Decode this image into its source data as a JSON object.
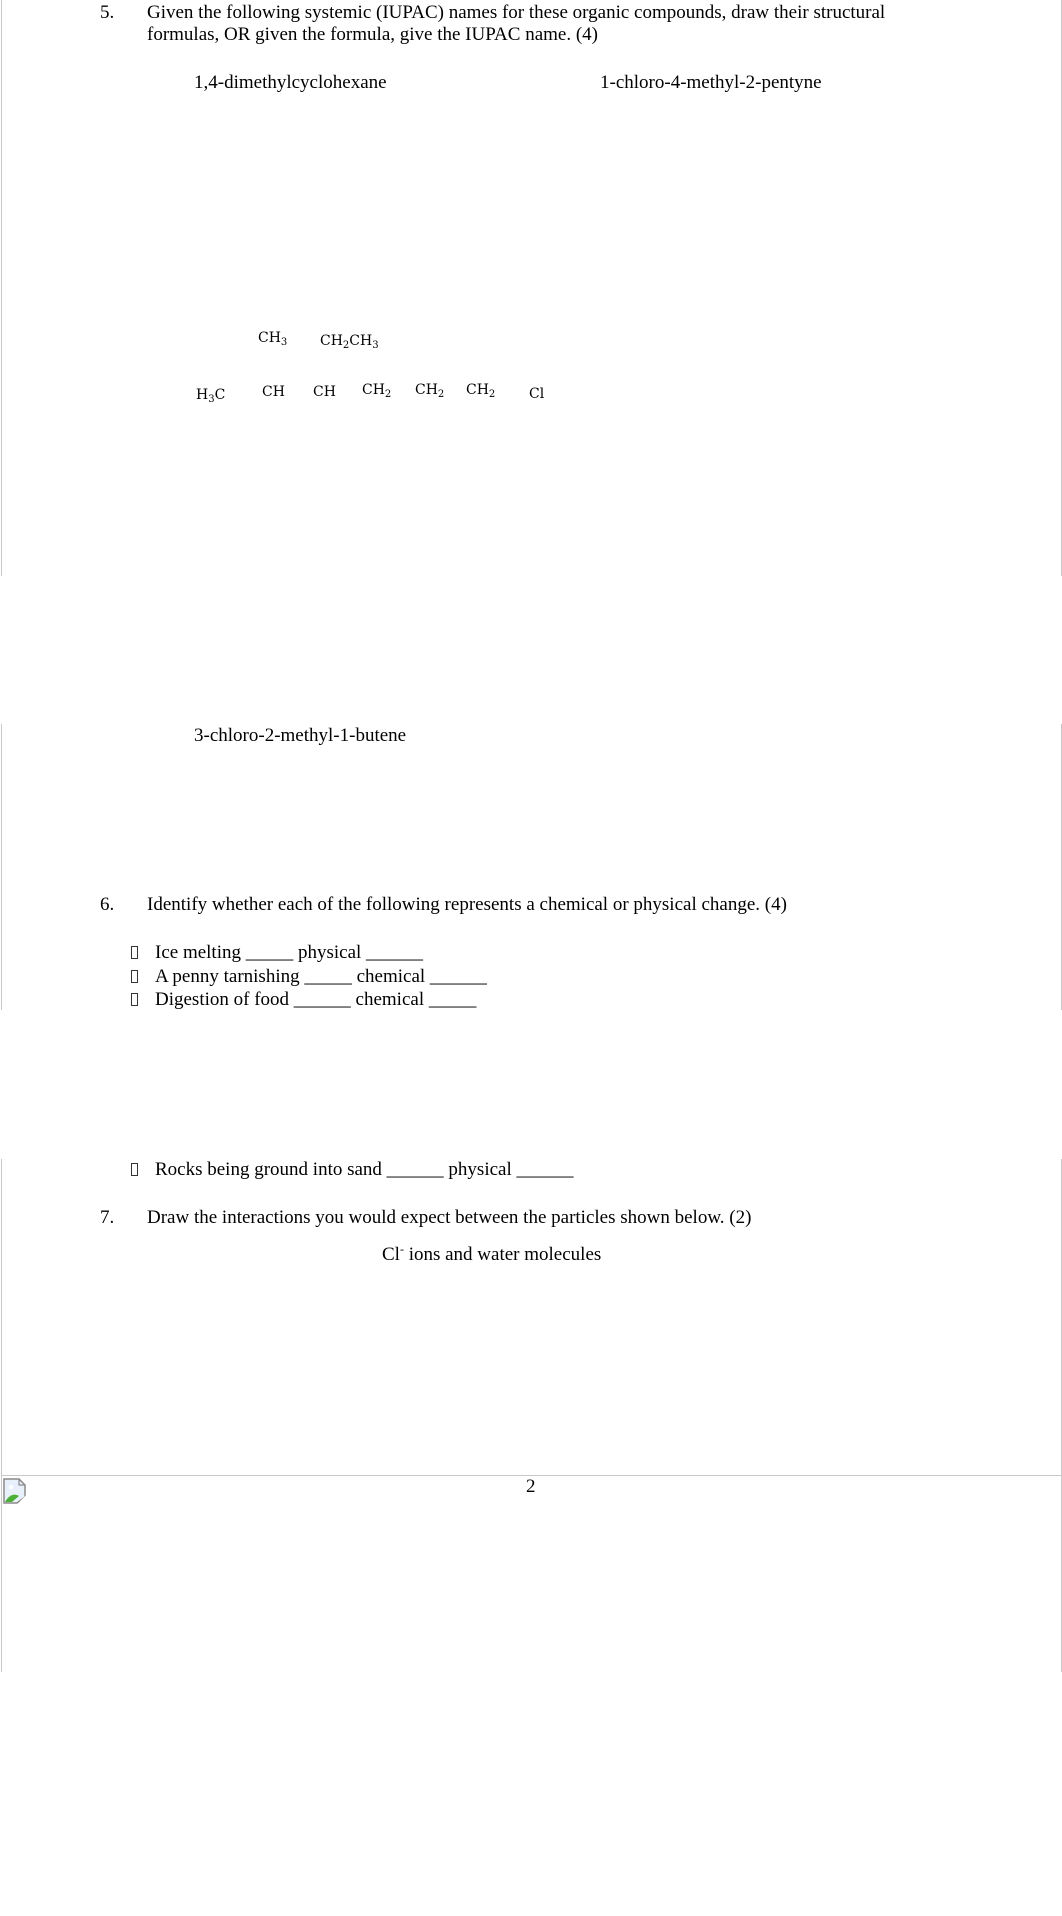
{
  "q5": {
    "number": "5.",
    "line1": "Given the following systemic (IUPAC) names for these organic compounds, draw their  structural",
    "line2": "formulas,  OR  given the formula, give the IUPAC name. (4)",
    "names": [
      "1,4-dimethylcyclohexane",
      "1-chloro-4-methyl-2-pentyne",
      "3-chloro-2-methyl-1-butene"
    ],
    "formula": {
      "top": [
        {
          "base": "CH",
          "sub": "3"
        },
        {
          "base": "CH",
          "sub": "2",
          "tail": "CH",
          "tailsub": "3"
        }
      ],
      "chain": [
        {
          "pre": "H",
          "presub": "3",
          "base": "C"
        },
        {
          "base": "CH"
        },
        {
          "base": "CH"
        },
        {
          "base": "CH",
          "sub": "2"
        },
        {
          "base": "CH",
          "sub": "2"
        },
        {
          "base": "CH",
          "sub": "2"
        },
        {
          "base": "Cl"
        }
      ]
    }
  },
  "q6": {
    "number": "6.",
    "prompt": "Identify whether each of the following represents a chemical  or physical  change. (4)",
    "items": [
      {
        "text": "Ice melting  _____ physical ______"
      },
      {
        "text": "A penny tarnishing  _____ chemical ______"
      },
      {
        "text": "Digestion of food  ______ chemical _____"
      },
      {
        "text": "Rocks being ground into sand  ______ physical ______"
      }
    ]
  },
  "q7": {
    "number": "7.",
    "prompt": "Draw the interactions    you would expect between the particles shown below. (2)",
    "ion": "Cl",
    "charge": "-",
    "rest": " ions and water molecules"
  },
  "footer": {
    "page_number": "2",
    "image_icon": "broken-image-icon"
  }
}
